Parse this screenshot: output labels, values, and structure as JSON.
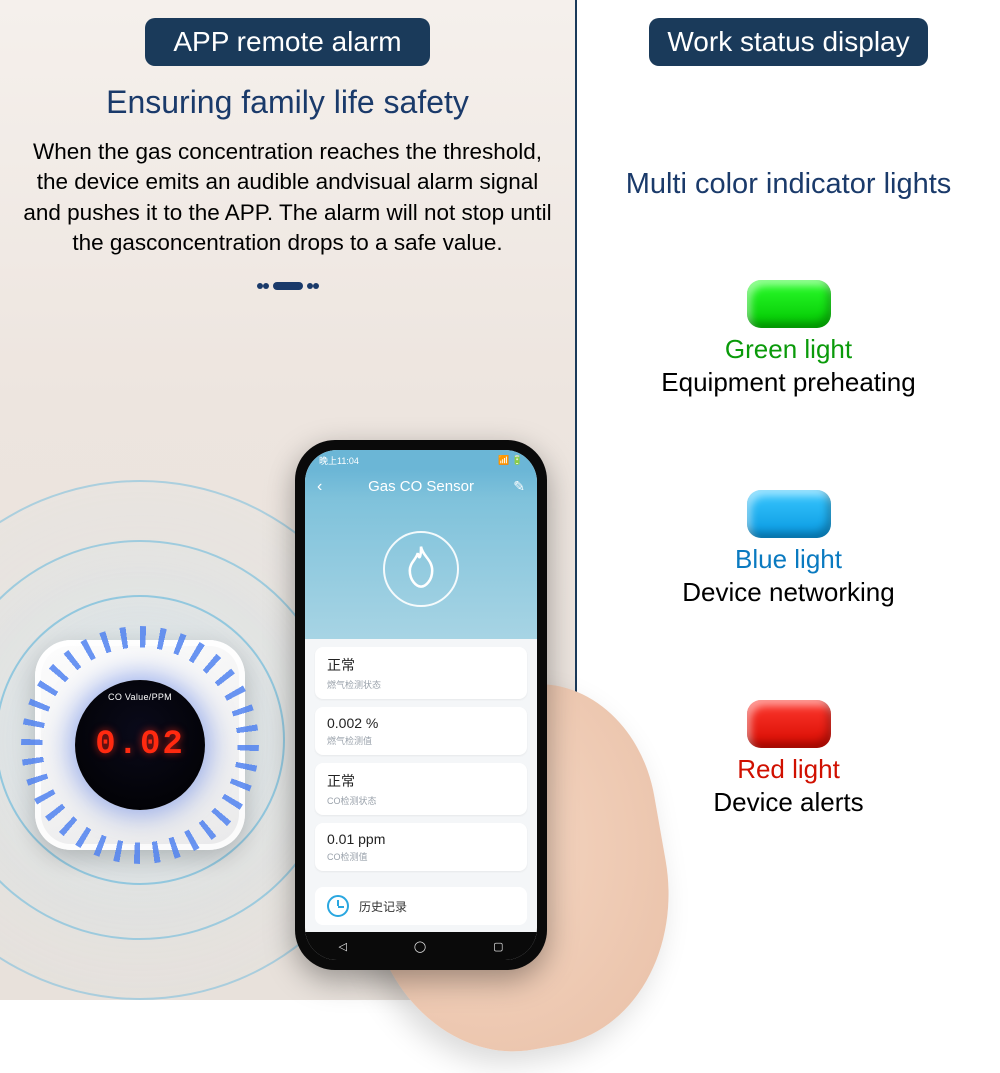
{
  "left": {
    "badge": "APP remote alarm",
    "subtitle": "Ensuring family life safety",
    "description": "When the gas concentration reaches the threshold, the device emits an audible andvisual alarm signal and pushes it to the APP. The alarm will not stop until the gasconcentration drops to a safe value."
  },
  "sensor": {
    "label": "CO Value/PPM",
    "value": "0.02"
  },
  "phone": {
    "status_time": "晚上11:04",
    "app_title": "Gas CO Sensor",
    "cards": [
      {
        "value": "正常",
        "sub": "燃气检测状态"
      },
      {
        "value": "0.002 %",
        "sub": "燃气检测值"
      },
      {
        "value": "正常",
        "sub": "CO检测状态"
      },
      {
        "value": "0.01 ppm",
        "sub": "CO检测值"
      }
    ],
    "history": "历史记录"
  },
  "right": {
    "badge": "Work status display",
    "subtitle": "Multi color indicator lights",
    "items": [
      {
        "color": "green",
        "name": "Green light",
        "desc": "Equipment preheating"
      },
      {
        "color": "blue",
        "name": "Blue light",
        "desc": "Device networking"
      },
      {
        "color": "red",
        "name": "Red light",
        "desc": "Device alerts"
      }
    ]
  }
}
